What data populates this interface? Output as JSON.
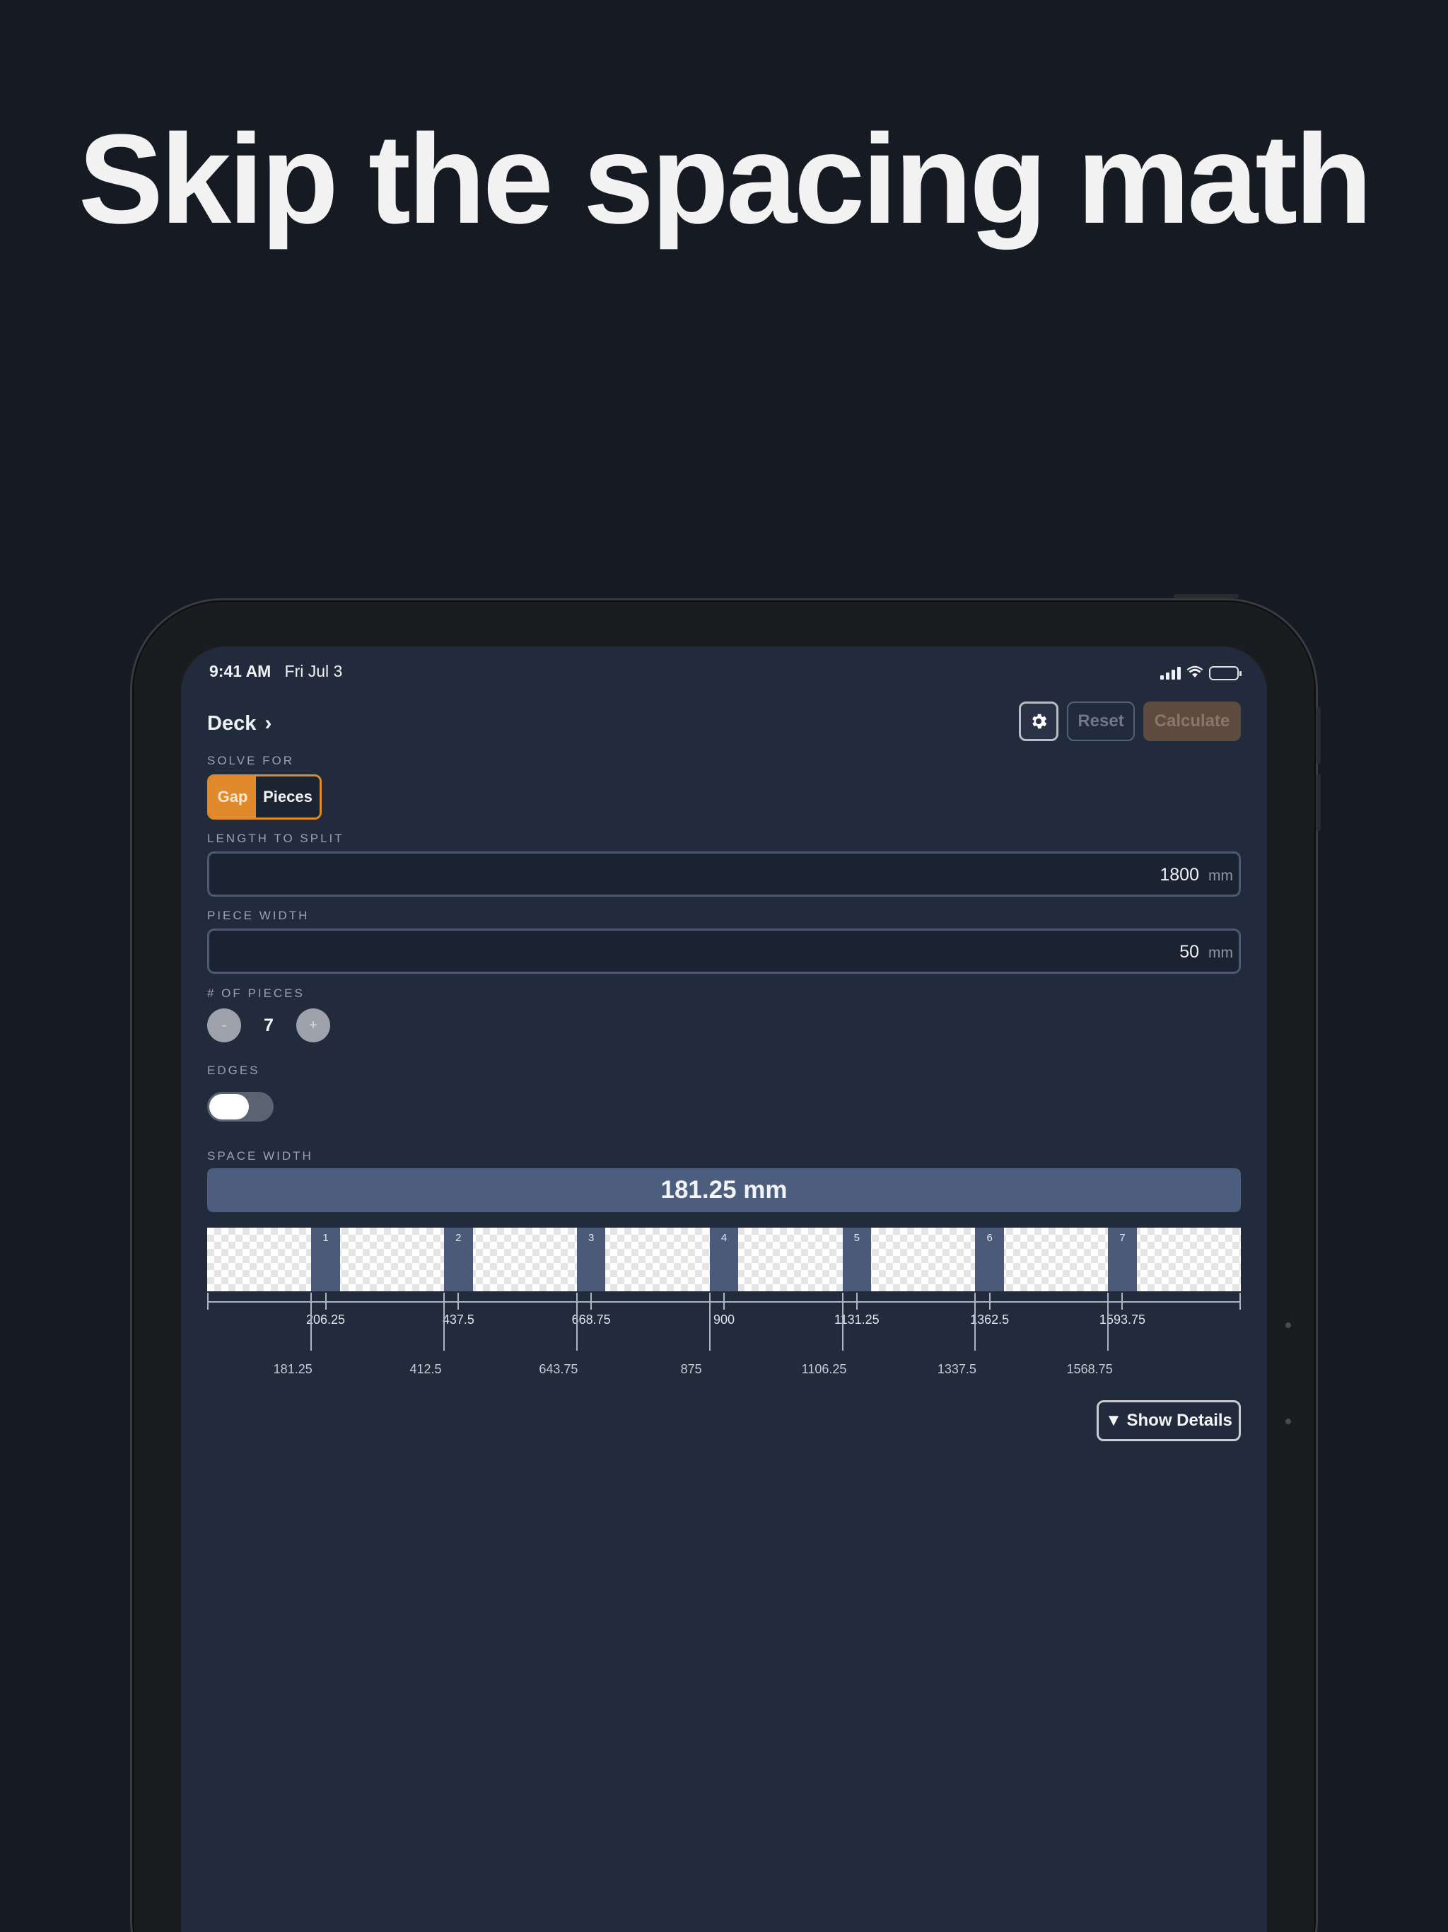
{
  "headline": "Skip the spacing math",
  "status_bar": {
    "time": "9:41 AM",
    "date": "Fri Jul 3"
  },
  "header": {
    "title": "Deck",
    "reset_label": "Reset",
    "calculate_label": "Calculate"
  },
  "solve_for": {
    "label": "SOLVE FOR",
    "options": [
      "Gap",
      "Pieces"
    ],
    "selected": "Gap"
  },
  "length_to_split": {
    "label": "LENGTH TO SPLIT",
    "value": "1800",
    "unit": "mm"
  },
  "piece_width": {
    "label": "PIECE WIDTH",
    "value": "50",
    "unit": "mm"
  },
  "num_pieces": {
    "label": "# OF PIECES",
    "minus": "-",
    "plus": "+",
    "value": "7"
  },
  "edges": {
    "label": "EDGES",
    "on": false
  },
  "space_width": {
    "label": "SPACE WIDTH",
    "value": "181.25 mm"
  },
  "diagram": {
    "total_length": 1800,
    "piece_width": 50,
    "pieces": [
      {
        "label": "1",
        "start": 181.25,
        "center": 206.25
      },
      {
        "label": "2",
        "start": 412.5,
        "center": 437.5
      },
      {
        "label": "3",
        "start": 643.75,
        "center": 668.75
      },
      {
        "label": "4",
        "start": 875,
        "center": 900
      },
      {
        "label": "5",
        "start": 1106.25,
        "center": 1131.25
      },
      {
        "label": "6",
        "start": 1337.5,
        "center": 1362.5
      },
      {
        "label": "7",
        "start": 1568.75,
        "center": 1593.75
      }
    ],
    "center_labels": [
      "206.25",
      "437.5",
      "668.75",
      "900",
      "1131.25",
      "1362.5",
      "1593.75"
    ],
    "start_labels": [
      "181.25",
      "412.5",
      "643.75",
      "875",
      "1106.25",
      "1337.5",
      "1568.75"
    ]
  },
  "details_button": "▼ Show Details",
  "colors": {
    "accent": "#e08a2c",
    "piece": "#4a5a78",
    "screen_bg": "#222b3b",
    "page_bg": "#151a23"
  }
}
